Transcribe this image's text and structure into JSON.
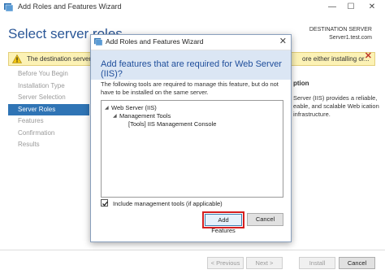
{
  "window": {
    "title": "Add Roles and Features Wizard",
    "controls": {
      "minimize": "—",
      "maximize": "☐",
      "close": "✕"
    }
  },
  "header": {
    "page_title": "Select server roles",
    "destination_label": "DESTINATION SERVER",
    "destination_server": "Server1.test.com"
  },
  "warning": {
    "text_left": "The destination server ha",
    "text_right": "ore either installing or...",
    "icon": "warning-icon",
    "close_glyph": "✕"
  },
  "nav": {
    "items": [
      {
        "label": "Before You Begin",
        "active": false
      },
      {
        "label": "Installation Type",
        "active": false
      },
      {
        "label": "Server Selection",
        "active": false
      },
      {
        "label": "Server Roles",
        "active": true
      },
      {
        "label": "Features",
        "active": false
      },
      {
        "label": "Confirmation",
        "active": false
      },
      {
        "label": "Results",
        "active": false
      }
    ]
  },
  "description": {
    "heading": "ption",
    "text": "Server (IIS) provides a reliable, eable, and scalable Web ication infrastructure."
  },
  "footer": {
    "previous": "< Previous",
    "next": "Next >",
    "install": "Install",
    "cancel": "Cancel"
  },
  "dialog": {
    "title": "Add Roles and Features Wizard",
    "close": "✕",
    "heading": "Add features that are required for Web Server (IIS)?",
    "body": "The following tools are required to manage this feature, but do not have to be installed on the same server.",
    "tree": [
      {
        "label": "Web Server (IIS)",
        "level": 0,
        "expanded": true
      },
      {
        "label": "Management Tools",
        "level": 1,
        "expanded": true
      },
      {
        "label": "[Tools] IIS Management Console",
        "level": 2,
        "expanded": false
      }
    ],
    "include_tools_label": "Include management tools (if applicable)",
    "include_tools_checked": true,
    "add_features": "Add Features",
    "cancel": "Cancel"
  },
  "colors": {
    "accent": "#2f74b5",
    "title_blue": "#2b5797",
    "warning_bg": "#fcf2b5",
    "dialog_header_bg": "#dbe6f4",
    "highlight_red": "#d51f1f"
  }
}
